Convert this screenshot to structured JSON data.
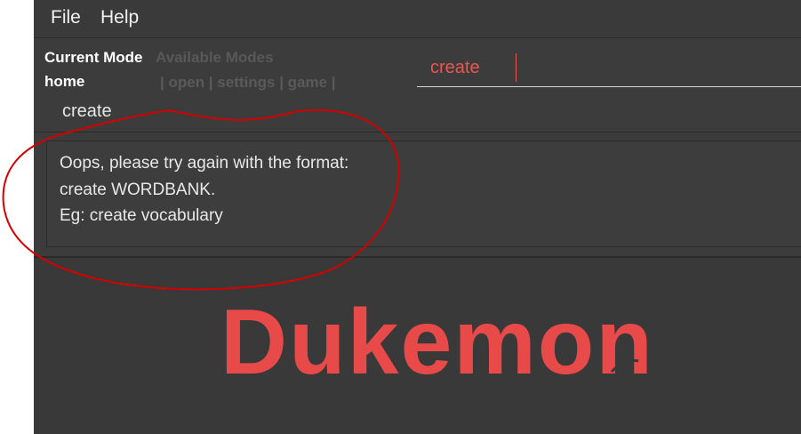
{
  "menu": {
    "file_label": "File",
    "help_label": "Help"
  },
  "mode": {
    "current_label": "Current Mode",
    "current_value": "home",
    "available_label": "Available Modes",
    "available_list": "| open | settings | game |"
  },
  "command": {
    "value": "create"
  },
  "echo": {
    "text": "create"
  },
  "result": {
    "lines": [
      "Oops, please try again with the format:",
      "create WORDBANK.",
      "Eg: create vocabulary"
    ]
  },
  "logo": {
    "text": "Dukemon",
    "color": "#e84a4a"
  },
  "colors": {
    "background": "#3c3c3c",
    "accent": "#e8584f",
    "annotation": "#d40000"
  }
}
